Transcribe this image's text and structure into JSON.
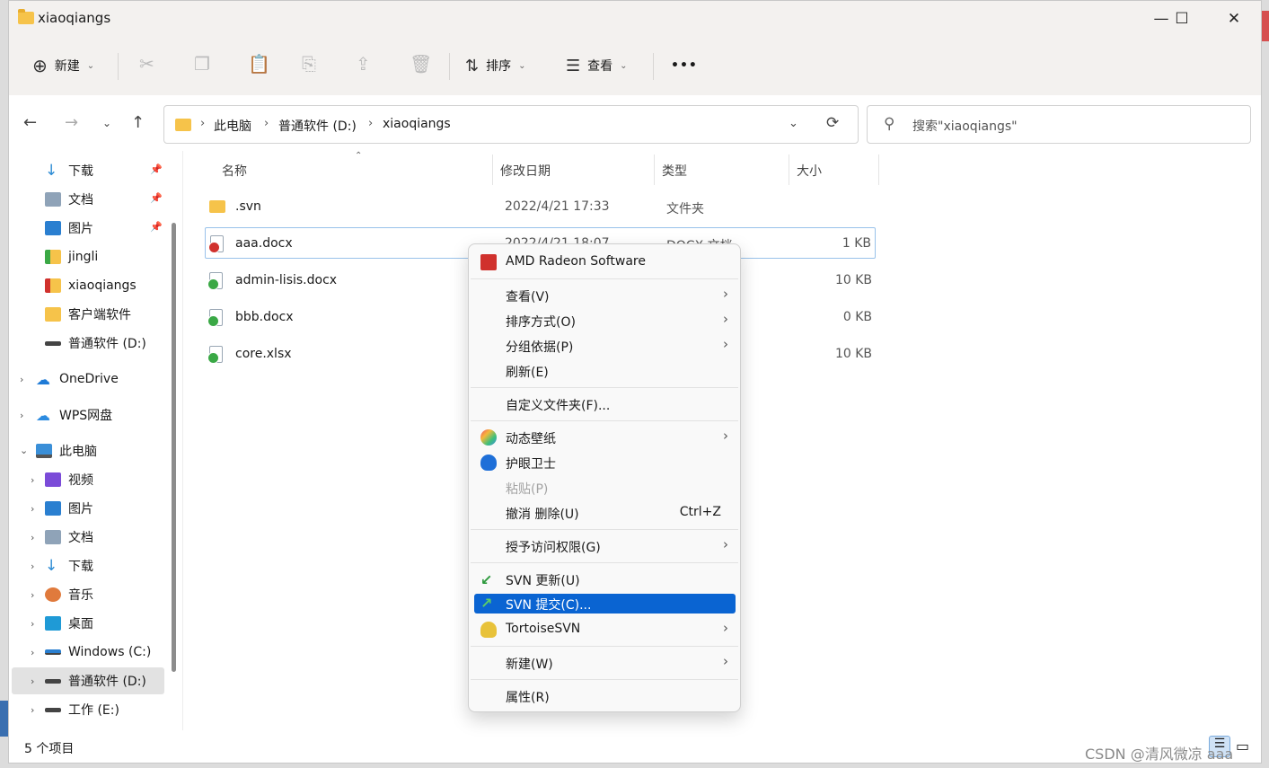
{
  "window": {
    "title": "xiaoqiangs",
    "controls": [
      "—",
      "☐",
      "✕"
    ]
  },
  "toolbar": {
    "new_label": "新建",
    "sort_label": "排序",
    "view_label": "查看",
    "more_label": "•••"
  },
  "address": {
    "crumbs": [
      "此电脑",
      "普通软件 (D:)",
      "xiaoqiangs"
    ]
  },
  "search": {
    "placeholder": "搜索\"xiaoqiangs\""
  },
  "sidebar": {
    "quick": [
      {
        "label": "下载",
        "icon": "download-icon",
        "pinned": true
      },
      {
        "label": "文档",
        "icon": "document-icon",
        "pinned": true
      },
      {
        "label": "图片",
        "icon": "pictures-icon",
        "pinned": true
      },
      {
        "label": "jingli",
        "icon": "svn-folder-icon",
        "pinned": false
      },
      {
        "label": "xiaoqiangs",
        "icon": "svn-folder-modified-icon",
        "pinned": false
      },
      {
        "label": "客户端软件",
        "icon": "folder-icon",
        "pinned": false
      },
      {
        "label": "普通软件 (D:)",
        "icon": "drive-icon",
        "pinned": false
      }
    ],
    "onedrive": "OneDrive",
    "wps": "WPS网盘",
    "thispc": "此电脑",
    "pc_items": [
      {
        "label": "视频",
        "icon": "video-icon"
      },
      {
        "label": "图片",
        "icon": "pictures-icon"
      },
      {
        "label": "文档",
        "icon": "document-icon"
      },
      {
        "label": "下载",
        "icon": "download-icon"
      },
      {
        "label": "音乐",
        "icon": "music-icon"
      },
      {
        "label": "桌面",
        "icon": "desktop-icon"
      },
      {
        "label": "Windows (C:)",
        "icon": "windows-drive-icon"
      },
      {
        "label": "普通软件 (D:)",
        "icon": "drive-icon"
      },
      {
        "label": "工作 (E:)",
        "icon": "drive-icon"
      }
    ]
  },
  "columns": {
    "name": "名称",
    "modified": "修改日期",
    "type": "类型",
    "size": "大小"
  },
  "files": [
    {
      "name": ".svn",
      "modified": "2022/4/21 17:33",
      "type": "文件夹",
      "size": ""
    },
    {
      "name": "aaa.docx",
      "modified": "2022/4/21 18:07",
      "type": "DOCX 文档",
      "size": "1 KB"
    },
    {
      "name": "admin-lisis.docx",
      "modified": "",
      "type": "",
      "size": "10 KB"
    },
    {
      "name": "bbb.docx",
      "modified": "",
      "type": "",
      "size": "0 KB"
    },
    {
      "name": "core.xlsx",
      "modified": "",
      "type": "",
      "size": "10 KB"
    }
  ],
  "status": {
    "count": "5 个项目"
  },
  "context_menu": {
    "amd": "AMD Radeon Software",
    "view": "查看(V)",
    "sort": "排序方式(O)",
    "group": "分组依据(P)",
    "refresh": "刷新(E)",
    "customize": "自定义文件夹(F)...",
    "wallpaper": "动态壁纸",
    "eyecare": "护眼卫士",
    "paste": "粘贴(P)",
    "undo": "撤消 删除(U)",
    "undo_shortcut": "Ctrl+Z",
    "grant": "授予访问权限(G)",
    "svn_update": "SVN 更新(U)",
    "svn_commit": "SVN 提交(C)...",
    "tortoise": "TortoiseSVN",
    "new": "新建(W)",
    "properties": "属性(R)"
  },
  "watermark": "CSDN @清风微凉 aaa",
  "colors": {
    "accent": "#0a64d2",
    "folder": "#f6c34a",
    "svn_ok": "#3aa845",
    "svn_modified": "#d0312d"
  }
}
